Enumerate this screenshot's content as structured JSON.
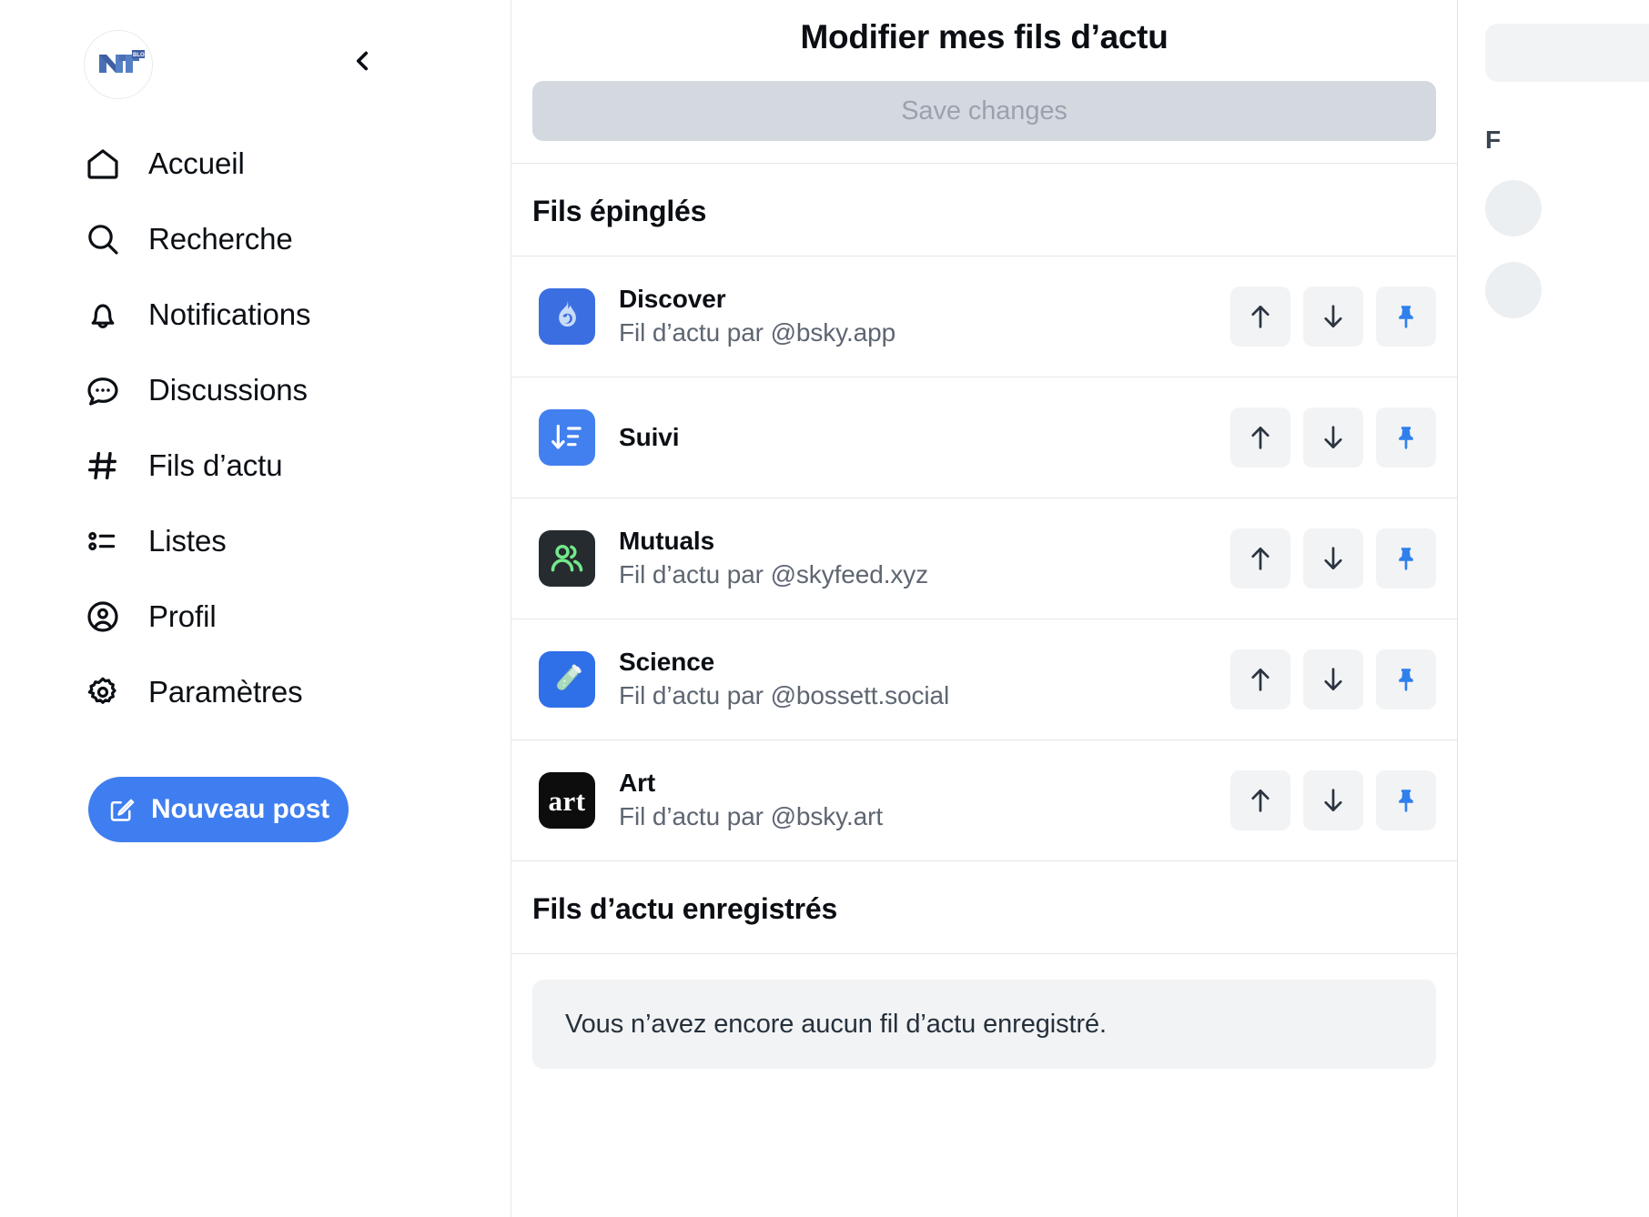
{
  "sidebar": {
    "logo_alt": "NT BLOG",
    "collapse_icon": "chevron-left-icon",
    "items": [
      {
        "label": "Accueil",
        "icon": "home-icon"
      },
      {
        "label": "Recherche",
        "icon": "search-icon"
      },
      {
        "label": "Notifications",
        "icon": "bell-icon"
      },
      {
        "label": "Discussions",
        "icon": "chat-bubble-icon"
      },
      {
        "label": "Fils d’actu",
        "icon": "hashtag-icon"
      },
      {
        "label": "Listes",
        "icon": "list-icon"
      },
      {
        "label": "Profil",
        "icon": "person-circle-icon"
      },
      {
        "label": "Paramètres",
        "icon": "gear-icon"
      }
    ],
    "compose": {
      "label": "Nouveau post",
      "icon": "compose-icon"
    }
  },
  "main": {
    "title": "Modifier mes fils d’actu",
    "save_button": {
      "label": "Save changes",
      "enabled": false
    },
    "pinned_section": {
      "title": "Fils épinglés"
    },
    "pinned_feeds": [
      {
        "name": "Discover",
        "subtitle": "Fil d’actu par @bsky.app",
        "avatar": {
          "type": "flame-icon",
          "bg": "#3b6ee0",
          "fg": "#c9dcf8"
        },
        "actions": [
          "move-up-icon",
          "move-down-icon",
          "pin-icon"
        ]
      },
      {
        "name": "Suivi",
        "subtitle": "",
        "avatar": {
          "type": "sort-descending-icon",
          "bg": "#4280ef",
          "fg": "#ffffff"
        },
        "actions": [
          "move-up-icon",
          "move-down-icon",
          "pin-icon"
        ]
      },
      {
        "name": "Mutuals",
        "subtitle": "Fil d’actu par @skyfeed.xyz",
        "avatar": {
          "type": "people-icon",
          "bg": "#262b2f",
          "fg": "#74e88a"
        },
        "actions": [
          "move-up-icon",
          "move-down-icon",
          "pin-icon"
        ]
      },
      {
        "name": "Science",
        "subtitle": "Fil d’actu par @bossett.social",
        "avatar": {
          "type": "test-tube-icon",
          "bg": "#2f6fe8",
          "fg": "#bfe6cf"
        },
        "actions": [
          "move-up-icon",
          "move-down-icon",
          "pin-icon"
        ]
      },
      {
        "name": "Art",
        "subtitle": "Fil d’actu par @bsky.art",
        "avatar": {
          "type": "art-text-icon",
          "bg": "#0d0d0d",
          "fg": "#ffffff",
          "text": "art"
        },
        "actions": [
          "move-up-icon",
          "move-down-icon",
          "pin-icon"
        ]
      }
    ],
    "saved_section": {
      "title": "Fils d’actu enregistrés"
    },
    "empty_message": "Vous n’avez encore aucun fil d’actu enregistré."
  },
  "right_rail": {
    "heading": "F"
  },
  "colors": {
    "accent": "#3f7ef0",
    "pin_active": "#2f80ed",
    "arrow": "#2b3440",
    "button_bg": "#f1f3f5",
    "save_disabled_bg": "#d4d9e0",
    "save_disabled_text": "#9aa2ae",
    "text_primary": "#0b0f14",
    "text_secondary": "#5e6672",
    "border": "#e4e6ea"
  }
}
